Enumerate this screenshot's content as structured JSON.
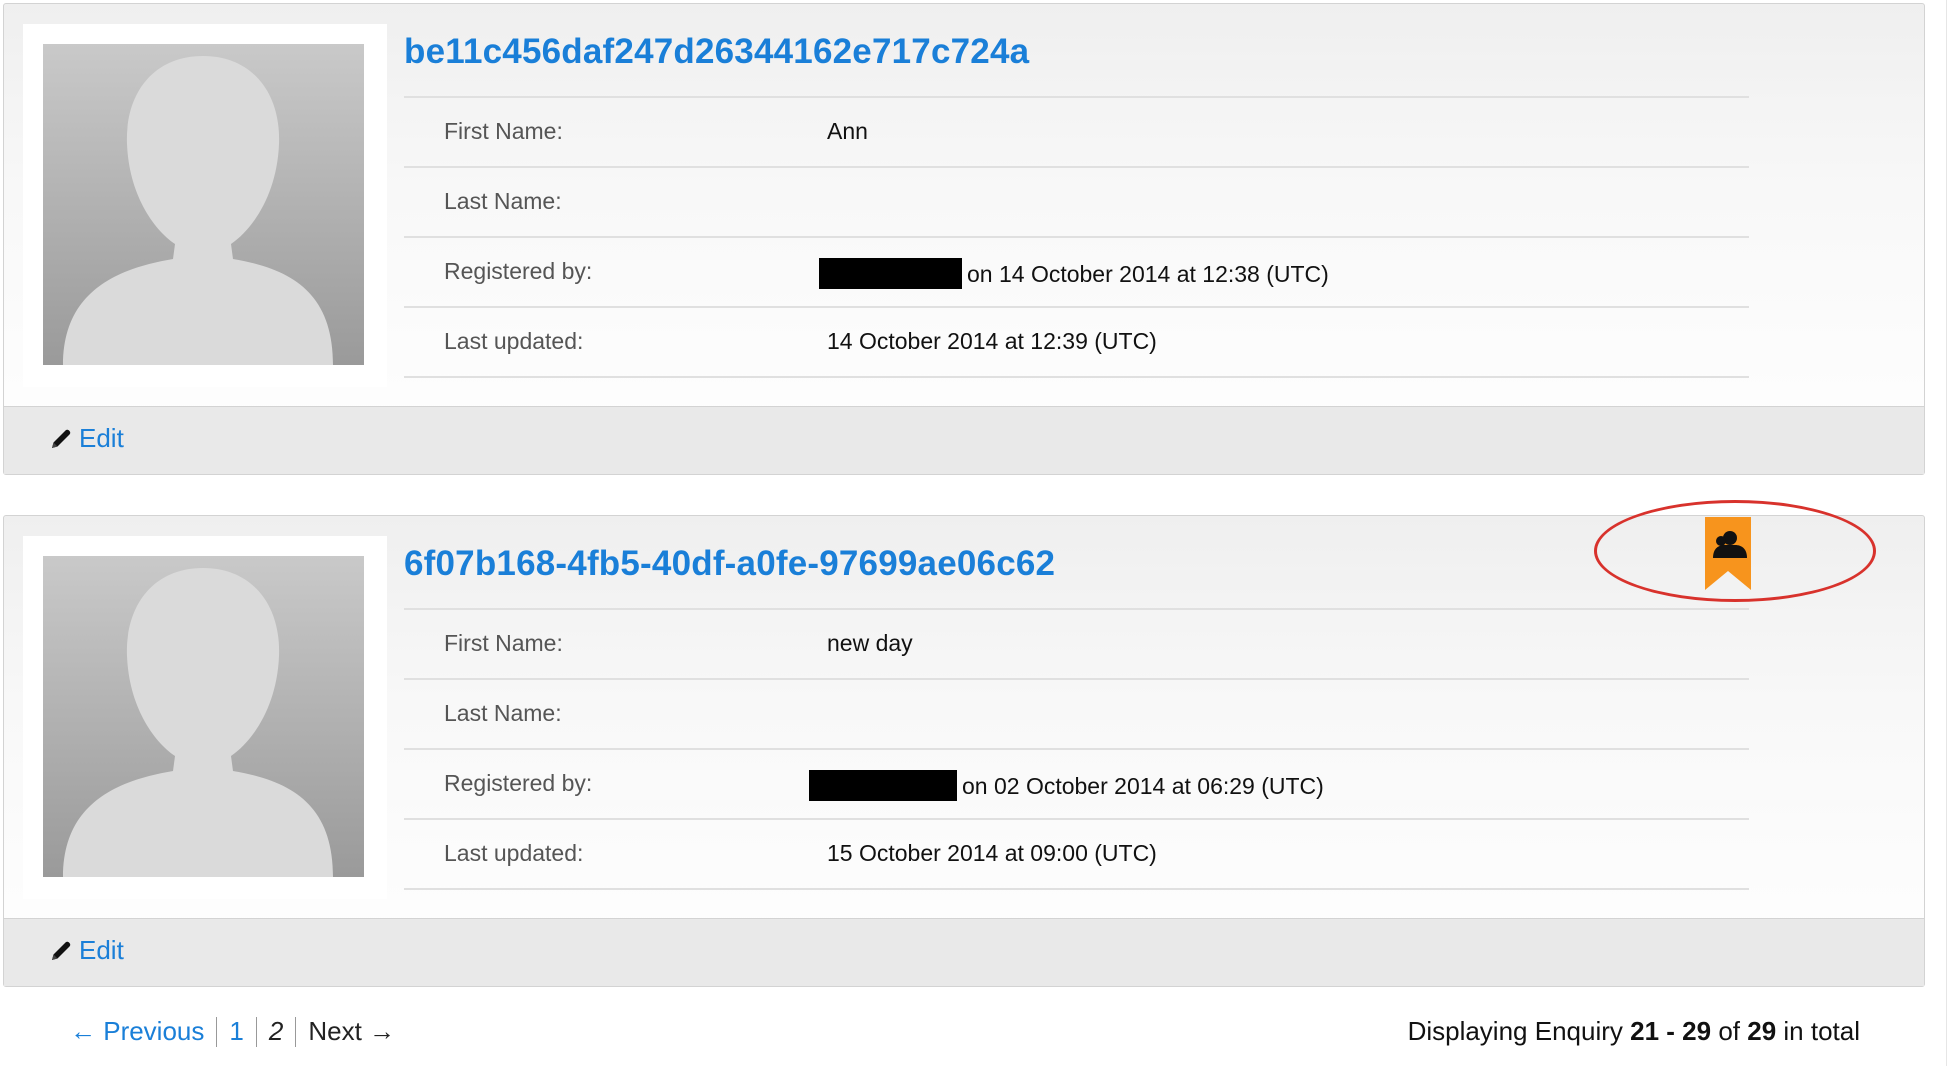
{
  "records": [
    {
      "id": "be11c456daf247d26344162e717c724a",
      "fields": [
        {
          "label": "First Name:",
          "value": "Ann"
        },
        {
          "label": "Last Name:",
          "value": ""
        },
        {
          "label": "Registered by:",
          "value": "on 14 October 2014 at 12:38 (UTC)"
        },
        {
          "label": "Last updated:",
          "value": "14 October 2014 at 12:39 (UTC)"
        }
      ],
      "edit_label": "Edit",
      "flagged": false
    },
    {
      "id": "6f07b168-4fb5-40df-a0fe-97699ae06c62",
      "fields": [
        {
          "label": "First Name:",
          "value": "new day"
        },
        {
          "label": "Last Name:",
          "value": ""
        },
        {
          "label": "Registered by:",
          "value": "on 02 October 2014 at 06:29 (UTC)"
        },
        {
          "label": "Last updated:",
          "value": "15 October 2014 at 09:00 (UTC)"
        }
      ],
      "edit_label": "Edit",
      "flagged": true
    }
  ],
  "pagination": {
    "previous_label": "← Previous",
    "pages": [
      "1",
      "2"
    ],
    "current_page": "2",
    "next_label": "Next →"
  },
  "summary": {
    "prefix": "Displaying Enquiry",
    "range": "21 - 29",
    "of_label": "of",
    "total": "29",
    "suffix": "in total"
  },
  "colors": {
    "link": "#1a7fd8",
    "flag": "#f7941d",
    "highlight": "#d8322c"
  },
  "icons": {
    "edit": "pencil-icon",
    "flag": "flagged-record-icon",
    "photo": "avatar-placeholder"
  }
}
